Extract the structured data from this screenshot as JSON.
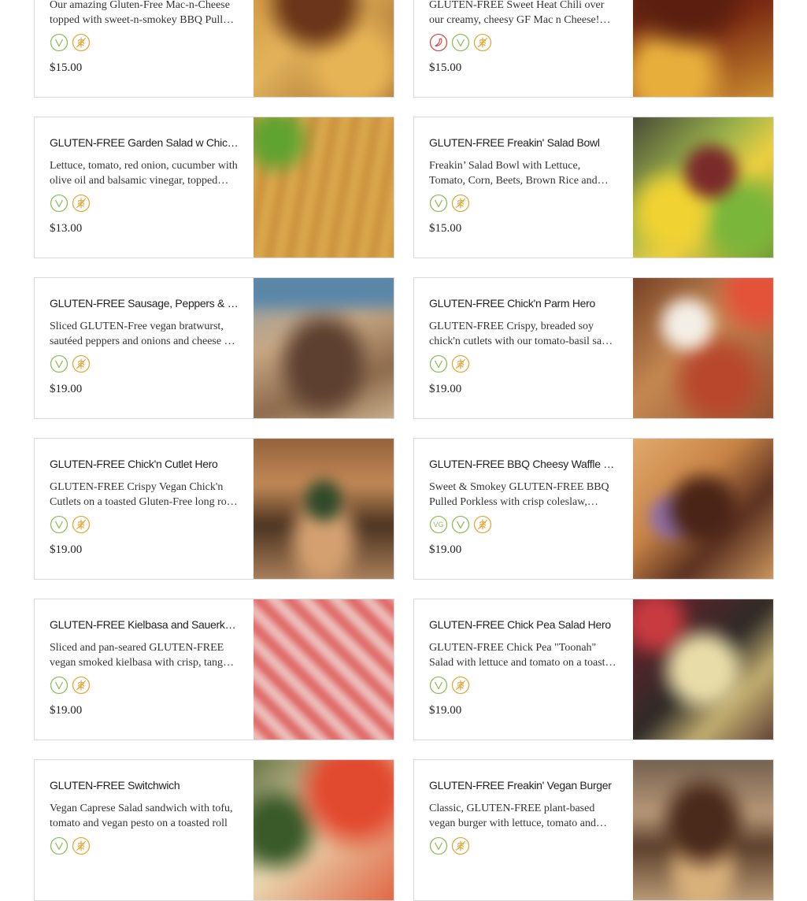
{
  "colors": {
    "vegan": "#8bbf5a",
    "gluten_free": "#e0a93b",
    "spicy": "#d24a43",
    "card_border": "#d9d9d9"
  },
  "items": [
    {
      "title": "",
      "desc": "Our amazing Gluten-Free Mac-n-Cheese topped with sweet-n-smokey BBQ Pulled Porkless",
      "price": "$15.00",
      "tags": [
        "vegan-icon",
        "gluten-free-icon"
      ],
      "photo": "mac-bbq"
    },
    {
      "title": "",
      "desc": "GLUTEN-FREE Sweet Heat Chili over our creamy, cheesy GF Mac n Cheese! Topped with scallions",
      "price": "$15.00",
      "tags": [
        "spicy-icon",
        "vegan-icon",
        "gluten-free-icon"
      ],
      "photo": "chili-mac"
    },
    {
      "title": "GLUTEN-FREE Garden Salad w Chick'n",
      "desc": "Lettuce, tomato, red onion, cucumber with olive oil and balsamic vinegar, topped with chick'n",
      "price": "$13.00",
      "tags": [
        "vegan-icon",
        "gluten-free-icon"
      ],
      "photo": "fries"
    },
    {
      "title": "GLUTEN-FREE Freakin' Salad Bowl",
      "desc": "Freakin’ Salad Bowl with Lettuce, Tomato, Corn, Beets, Brown Rice and more",
      "price": "$15.00",
      "tags": [
        "vegan-icon",
        "gluten-free-icon"
      ],
      "photo": "salad-bowl"
    },
    {
      "title": "GLUTEN-FREE Sausage, Peppers & Onions Hero",
      "desc": "Sliced GLUTEN-Free vegan bratwurst, sautéed peppers and onions and cheese on a toasted roll",
      "price": "$19.00",
      "tags": [
        "vegan-icon",
        "gluten-free-icon"
      ],
      "photo": "sausage-hero"
    },
    {
      "title": "GLUTEN-FREE Chick'n Parm Hero",
      "desc": "GLUTEN-FREE Crispy, breaded soy chick'n cutlets with our tomato-basil sauce and cheese",
      "price": "$19.00",
      "tags": [
        "vegan-icon",
        "gluten-free-icon"
      ],
      "photo": "parm-hero"
    },
    {
      "title": "GLUTEN-FREE Chick'n Cutlet Hero",
      "desc": "GLUTEN-FREE Crispy Vegan Chick'n Cutlets on a toasted Gluten-Free long roll with lettuce",
      "price": "$19.00",
      "tags": [
        "vegan-icon",
        "gluten-free-icon"
      ],
      "photo": "cutlet-hero"
    },
    {
      "title": "GLUTEN-FREE BBQ Cheesy Waffle Fry Sandwich",
      "desc": "Sweet & Smokey GLUTEN-FREE BBQ Pulled Porkless with crisp coleslaw, cheese and waffle fries",
      "price": "$19.00",
      "tags": [
        "vegetarian-icon",
        "vegan-icon",
        "gluten-free-icon"
      ],
      "photo": "bbq-sandwich"
    },
    {
      "title": "GLUTEN-FREE Kielbasa and Sauerkraut Hero",
      "desc": "Sliced and pan-seared GLUTEN-FREE vegan smoked kielbasa with crisp, tangy sauerkraut",
      "price": "$19.00",
      "tags": [
        "vegan-icon",
        "gluten-free-icon"
      ],
      "photo": "kielbasa-hero"
    },
    {
      "title": "GLUTEN-FREE Chick Pea Salad Hero",
      "desc": "GLUTEN-FREE Chick Pea \"Toonah\" Salad with lettuce and tomato on a toasted roll",
      "price": "$19.00",
      "tags": [
        "vegan-icon",
        "gluten-free-icon"
      ],
      "photo": "chickpea-hero"
    },
    {
      "title": "GLUTEN-FREE Switchwich",
      "desc": "Vegan Caprese Salad sandwich with tofu, tomato and vegan pesto on a toasted roll",
      "price": "",
      "tags": [
        "vegan-icon",
        "gluten-free-icon"
      ],
      "photo": "switchwich"
    },
    {
      "title": "GLUTEN-FREE Freakin' Vegan Burger",
      "desc": "Classic, GLUTEN-FREE plant-based vegan burger with lettuce, tomato and onion",
      "price": "",
      "tags": [
        "vegan-icon",
        "gluten-free-icon"
      ],
      "photo": "vegan-burger"
    }
  ]
}
